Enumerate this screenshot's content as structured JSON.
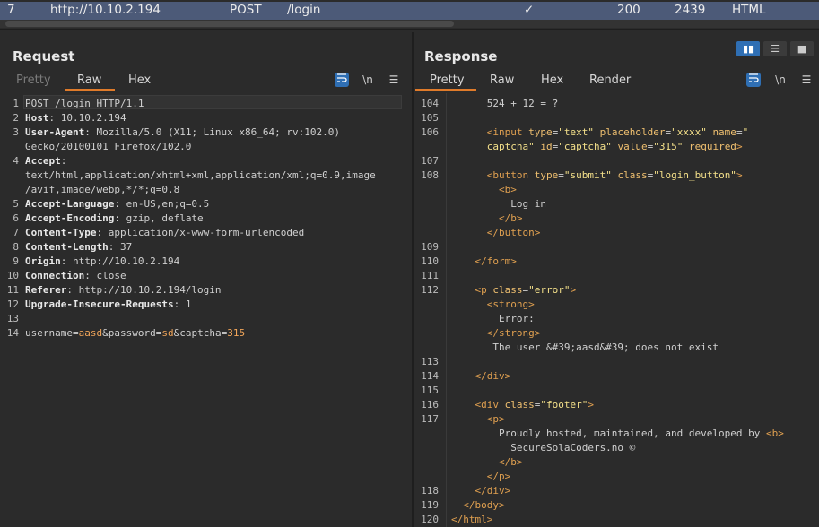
{
  "history_row": {
    "number": "7",
    "url": "http://10.10.2.194",
    "method": "POST",
    "path": "/login",
    "checkmark": "✓",
    "status": "200",
    "length": "2439",
    "mime": "HTML"
  },
  "layout_buttons": [
    "split-horizontal-icon",
    "split-vertical-icon",
    "single-pane-icon"
  ],
  "request": {
    "title": "Request",
    "tabs": [
      {
        "label": "Pretty",
        "dim": true
      },
      {
        "label": "Raw",
        "active": true
      },
      {
        "label": "Hex"
      }
    ],
    "tools": {
      "wrap": "wrap-icon",
      "newline": "\\n",
      "menu": "menu-icon"
    },
    "lines": [
      {
        "n": "1",
        "segs": [
          {
            "t": "POST /login HTTP/1.1",
            "c": "txt"
          }
        ]
      },
      {
        "n": "2",
        "segs": [
          {
            "t": "Host",
            "c": "key"
          },
          {
            "t": ": 10.10.2.194",
            "c": "txt"
          }
        ]
      },
      {
        "n": "3",
        "segs": [
          {
            "t": "User-Agent",
            "c": "key"
          },
          {
            "t": ": Mozilla/5.0 (X11; Linux x86_64; rv:102.0)",
            "c": "txt"
          }
        ]
      },
      {
        "n": "",
        "segs": [
          {
            "t": "Gecko/20100101 Firefox/102.0",
            "c": "txt"
          }
        ]
      },
      {
        "n": "4",
        "segs": [
          {
            "t": "Accept",
            "c": "key"
          },
          {
            "t": ":",
            "c": "txt"
          }
        ]
      },
      {
        "n": "",
        "segs": [
          {
            "t": "text/html,application/xhtml+xml,application/xml;q=0.9,image",
            "c": "txt"
          }
        ]
      },
      {
        "n": "",
        "segs": [
          {
            "t": "/avif,image/webp,*/*;q=0.8",
            "c": "txt"
          }
        ]
      },
      {
        "n": "5",
        "segs": [
          {
            "t": "Accept-Language",
            "c": "key"
          },
          {
            "t": ": en-US,en;q=0.5",
            "c": "txt"
          }
        ]
      },
      {
        "n": "6",
        "segs": [
          {
            "t": "Accept-Encoding",
            "c": "key"
          },
          {
            "t": ": gzip, deflate",
            "c": "txt"
          }
        ]
      },
      {
        "n": "7",
        "segs": [
          {
            "t": "Content-Type",
            "c": "key"
          },
          {
            "t": ": application/x-www-form-urlencoded",
            "c": "txt"
          }
        ]
      },
      {
        "n": "8",
        "segs": [
          {
            "t": "Content-Length",
            "c": "key"
          },
          {
            "t": ": 37",
            "c": "txt"
          }
        ]
      },
      {
        "n": "9",
        "segs": [
          {
            "t": "Origin",
            "c": "key"
          },
          {
            "t": ": http://10.10.2.194",
            "c": "txt"
          }
        ]
      },
      {
        "n": "10",
        "segs": [
          {
            "t": "Connection",
            "c": "key"
          },
          {
            "t": ": close",
            "c": "txt"
          }
        ]
      },
      {
        "n": "11",
        "segs": [
          {
            "t": "Referer",
            "c": "key"
          },
          {
            "t": ": http://10.10.2.194/login",
            "c": "txt"
          }
        ]
      },
      {
        "n": "12",
        "segs": [
          {
            "t": "Upgrade-Insecure-Requests",
            "c": "key"
          },
          {
            "t": ": 1",
            "c": "txt"
          }
        ]
      },
      {
        "n": "13",
        "segs": []
      },
      {
        "n": "14",
        "segs": [
          {
            "t": "username",
            "c": "txt"
          },
          {
            "t": "=",
            "c": "txt"
          },
          {
            "t": "aasd",
            "c": "pval"
          },
          {
            "t": "&password",
            "c": "txt"
          },
          {
            "t": "=",
            "c": "txt"
          },
          {
            "t": "sd",
            "c": "pval"
          },
          {
            "t": "&captcha",
            "c": "txt"
          },
          {
            "t": "=",
            "c": "txt"
          },
          {
            "t": "315",
            "c": "pval"
          }
        ]
      }
    ]
  },
  "response": {
    "title": "Response",
    "tabs": [
      {
        "label": "Pretty",
        "active": true
      },
      {
        "label": "Raw"
      },
      {
        "label": "Hex"
      },
      {
        "label": "Render"
      }
    ],
    "tools": {
      "wrap": "wrap-icon",
      "newline": "\\n",
      "menu": "menu-icon"
    },
    "lines": [
      {
        "n": "104",
        "segs": [
          {
            "t": "      524 + 12 = ?",
            "c": "txt"
          }
        ]
      },
      {
        "n": "105",
        "segs": []
      },
      {
        "n": "106",
        "segs": [
          {
            "t": "      ",
            "c": "txt"
          },
          {
            "t": "<input ",
            "c": "tag"
          },
          {
            "t": "type",
            "c": "attr"
          },
          {
            "t": "=",
            "c": "txt"
          },
          {
            "t": "\"text\" ",
            "c": "str"
          },
          {
            "t": "placeholder",
            "c": "attr"
          },
          {
            "t": "=",
            "c": "txt"
          },
          {
            "t": "\"xxxx\" ",
            "c": "str"
          },
          {
            "t": "name",
            "c": "attr"
          },
          {
            "t": "=",
            "c": "txt"
          },
          {
            "t": "\"",
            "c": "str"
          }
        ]
      },
      {
        "n": "",
        "segs": [
          {
            "t": "      captcha\" ",
            "c": "str"
          },
          {
            "t": "id",
            "c": "attr"
          },
          {
            "t": "=",
            "c": "txt"
          },
          {
            "t": "\"captcha\" ",
            "c": "str"
          },
          {
            "t": "value",
            "c": "attr"
          },
          {
            "t": "=",
            "c": "txt"
          },
          {
            "t": "\"315\" ",
            "c": "str"
          },
          {
            "t": "required",
            "c": "attr"
          },
          {
            "t": ">",
            "c": "tag"
          }
        ]
      },
      {
        "n": "107",
        "segs": []
      },
      {
        "n": "108",
        "segs": [
          {
            "t": "      ",
            "c": "txt"
          },
          {
            "t": "<button ",
            "c": "tag"
          },
          {
            "t": "type",
            "c": "attr"
          },
          {
            "t": "=",
            "c": "txt"
          },
          {
            "t": "\"submit\" ",
            "c": "str"
          },
          {
            "t": "class",
            "c": "attr"
          },
          {
            "t": "=",
            "c": "txt"
          },
          {
            "t": "\"login_button\"",
            "c": "str"
          },
          {
            "t": ">",
            "c": "tag"
          }
        ]
      },
      {
        "n": "",
        "segs": [
          {
            "t": "        ",
            "c": "txt"
          },
          {
            "t": "<b>",
            "c": "tag"
          }
        ]
      },
      {
        "n": "",
        "segs": [
          {
            "t": "          Log in",
            "c": "txt"
          }
        ]
      },
      {
        "n": "",
        "segs": [
          {
            "t": "        ",
            "c": "txt"
          },
          {
            "t": "</b>",
            "c": "tag"
          }
        ]
      },
      {
        "n": "",
        "segs": [
          {
            "t": "      ",
            "c": "txt"
          },
          {
            "t": "</button>",
            "c": "tag"
          }
        ]
      },
      {
        "n": "109",
        "segs": []
      },
      {
        "n": "110",
        "segs": [
          {
            "t": "    ",
            "c": "txt"
          },
          {
            "t": "</form>",
            "c": "tag"
          }
        ]
      },
      {
        "n": "111",
        "segs": []
      },
      {
        "n": "112",
        "segs": [
          {
            "t": "    ",
            "c": "txt"
          },
          {
            "t": "<p ",
            "c": "tag"
          },
          {
            "t": "class",
            "c": "attr"
          },
          {
            "t": "=",
            "c": "txt"
          },
          {
            "t": "\"error\"",
            "c": "str"
          },
          {
            "t": ">",
            "c": "tag"
          }
        ]
      },
      {
        "n": "",
        "segs": [
          {
            "t": "      ",
            "c": "txt"
          },
          {
            "t": "<strong>",
            "c": "tag"
          }
        ]
      },
      {
        "n": "",
        "segs": [
          {
            "t": "        Error:",
            "c": "txt"
          }
        ]
      },
      {
        "n": "",
        "segs": [
          {
            "t": "      ",
            "c": "txt"
          },
          {
            "t": "</strong>",
            "c": "tag"
          }
        ]
      },
      {
        "n": "",
        "segs": [
          {
            "t": "       The user &#39;aasd&#39; does not exist",
            "c": "txt"
          }
        ]
      },
      {
        "n": "113",
        "segs": []
      },
      {
        "n": "114",
        "segs": [
          {
            "t": "    ",
            "c": "txt"
          },
          {
            "t": "</div>",
            "c": "tag"
          }
        ]
      },
      {
        "n": "115",
        "segs": []
      },
      {
        "n": "116",
        "segs": [
          {
            "t": "    ",
            "c": "txt"
          },
          {
            "t": "<div ",
            "c": "tag"
          },
          {
            "t": "class",
            "c": "attr"
          },
          {
            "t": "=",
            "c": "txt"
          },
          {
            "t": "\"footer\"",
            "c": "str"
          },
          {
            "t": ">",
            "c": "tag"
          }
        ]
      },
      {
        "n": "117",
        "segs": [
          {
            "t": "      ",
            "c": "txt"
          },
          {
            "t": "<p>",
            "c": "tag"
          }
        ]
      },
      {
        "n": "",
        "segs": [
          {
            "t": "        Proudly hosted, maintained, and developed by ",
            "c": "txt"
          },
          {
            "t": "<b>",
            "c": "tag"
          }
        ]
      },
      {
        "n": "",
        "segs": [
          {
            "t": "          SecureSolaCoders.no ©",
            "c": "txt"
          }
        ]
      },
      {
        "n": "",
        "segs": [
          {
            "t": "        ",
            "c": "txt"
          },
          {
            "t": "</b>",
            "c": "tag"
          }
        ]
      },
      {
        "n": "",
        "segs": [
          {
            "t": "      ",
            "c": "txt"
          },
          {
            "t": "</p>",
            "c": "tag"
          }
        ]
      },
      {
        "n": "118",
        "segs": [
          {
            "t": "    ",
            "c": "txt"
          },
          {
            "t": "</div>",
            "c": "tag"
          }
        ]
      },
      {
        "n": "119",
        "segs": [
          {
            "t": "  ",
            "c": "txt"
          },
          {
            "t": "</body>",
            "c": "tag"
          }
        ]
      },
      {
        "n": "120",
        "segs": [
          {
            "t": "",
            "c": "txt"
          },
          {
            "t": "</html>",
            "c": "tag"
          }
        ]
      }
    ]
  }
}
